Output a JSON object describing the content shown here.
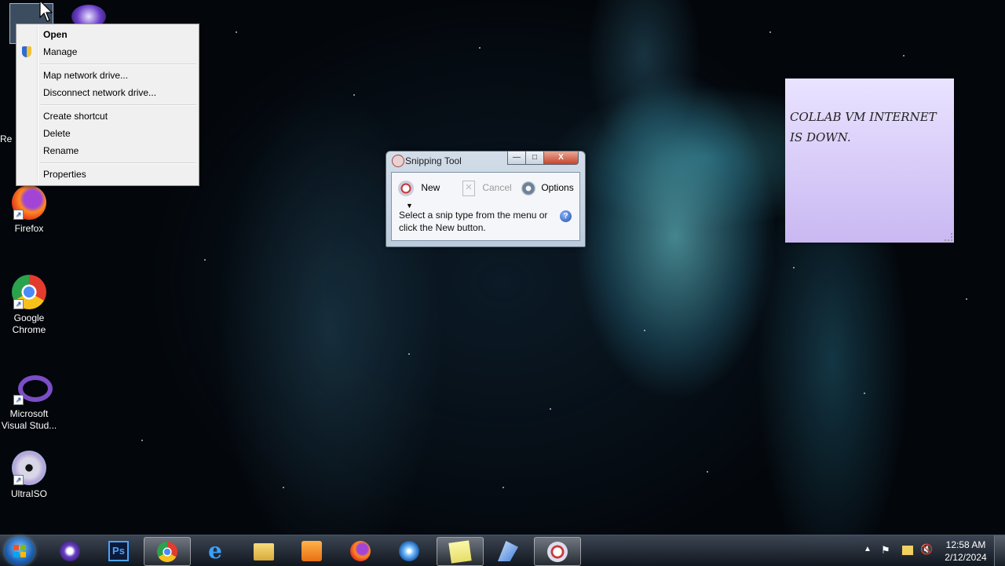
{
  "desktop": {
    "icons": [
      {
        "id": "recycle-bin",
        "label": "Re"
      },
      {
        "id": "firefox",
        "label": "Firefox"
      },
      {
        "id": "chrome",
        "label": "Google Chrome"
      },
      {
        "id": "visual-studio",
        "label": "Microsoft Visual Stud..."
      },
      {
        "id": "ultraiso",
        "label": "UltraISO"
      }
    ]
  },
  "context_menu": {
    "items": [
      "Open",
      "Manage",
      "Map network drive...",
      "Disconnect network drive...",
      "Create shortcut",
      "Delete",
      "Rename",
      "Properties"
    ]
  },
  "snipping_tool": {
    "title": "Snipping Tool",
    "new_label": "New",
    "cancel_label": "Cancel",
    "options_label": "Options",
    "message": "Select a snip type from the menu or click the New button.",
    "minimize": "—",
    "maximize": "□",
    "close": "X"
  },
  "sticky_note": {
    "text": "COLLAB VM INTERNET IS DOWN."
  },
  "taskbar": {
    "apps": [
      "media-player",
      "photoshop",
      "chrome",
      "internet-explorer",
      "file-explorer",
      "media-center",
      "firefox",
      "windows-explorer",
      "sticky-notes",
      "connection",
      "snipping-tool"
    ],
    "active": [
      "chrome",
      "snipping-tool",
      "sticky-notes"
    ],
    "time": "12:58 AM",
    "date": "2/12/2024"
  }
}
